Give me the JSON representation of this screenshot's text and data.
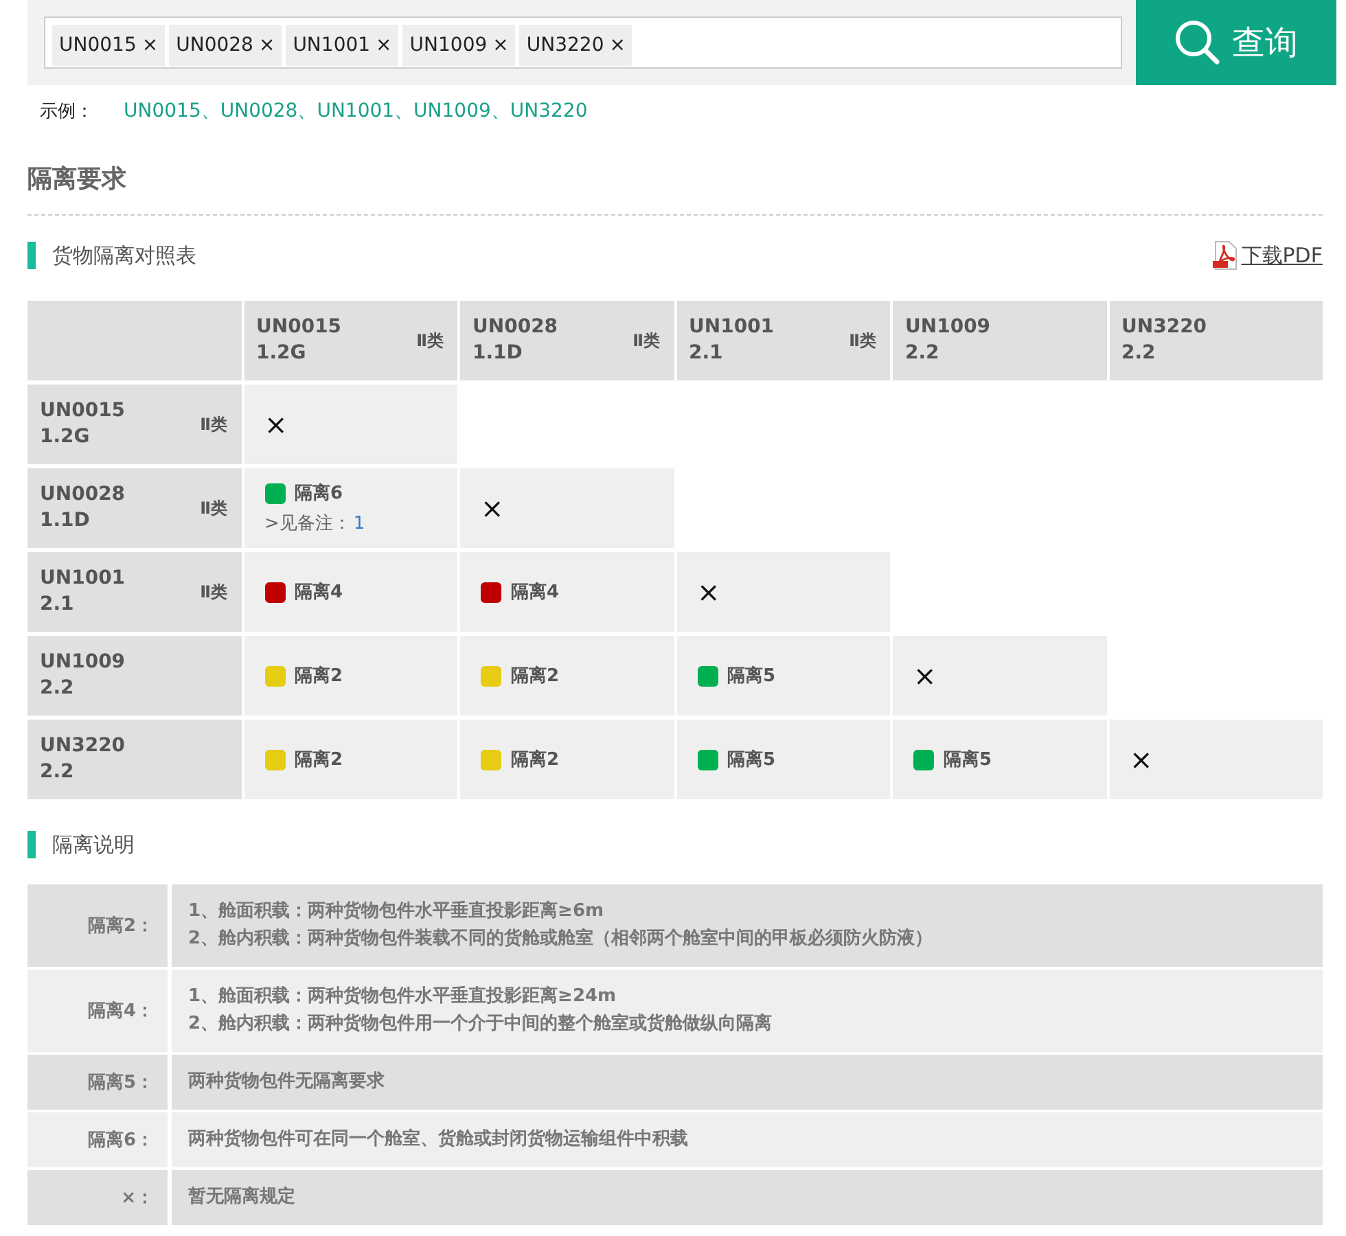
{
  "search": {
    "tags": [
      {
        "label": "UN0015",
        "remove": "×"
      },
      {
        "label": "UN0028",
        "remove": "×"
      },
      {
        "label": "UN1001",
        "remove": "×"
      },
      {
        "label": "UN1009",
        "remove": "×"
      },
      {
        "label": "UN3220",
        "remove": "×"
      }
    ],
    "button": "查询"
  },
  "example": {
    "label": "示例：",
    "value": "UN0015、UN0028、UN1001、UN1009、UN3220"
  },
  "section_title": "隔离要求",
  "matrix": {
    "title": "货物隔离对照表",
    "download": "下载PDF",
    "columns": [
      {
        "code": "UN0015",
        "class": "1.2G",
        "badge": "Ⅱ类"
      },
      {
        "code": "UN0028",
        "class": "1.1D",
        "badge": "Ⅱ类"
      },
      {
        "code": "UN1001",
        "class": "2.1",
        "badge": "Ⅱ类"
      },
      {
        "code": "UN1009",
        "class": "2.2"
      },
      {
        "code": "UN3220",
        "class": "2.2"
      }
    ],
    "rows": [
      {
        "code": "UN0015",
        "class": "1.2G",
        "badge": "Ⅱ类",
        "cells": [
          {
            "kind": "none",
            "text": "×"
          }
        ]
      },
      {
        "code": "UN0028",
        "class": "1.1D",
        "badge": "Ⅱ类",
        "cells": [
          {
            "kind": "level",
            "color": "#00b050",
            "label": "隔离6",
            "note": ">见备注：",
            "note_link": "1"
          },
          {
            "kind": "none",
            "text": "×"
          }
        ]
      },
      {
        "code": "UN1001",
        "class": "2.1",
        "badge": "Ⅱ类",
        "cells": [
          {
            "kind": "level",
            "color": "#c00000",
            "label": "隔离4"
          },
          {
            "kind": "level",
            "color": "#c00000",
            "label": "隔离4"
          },
          {
            "kind": "none",
            "text": "×"
          }
        ]
      },
      {
        "code": "UN1009",
        "class": "2.2",
        "cells": [
          {
            "kind": "level",
            "color": "#e6cc12",
            "label": "隔离2"
          },
          {
            "kind": "level",
            "color": "#e6cc12",
            "label": "隔离2"
          },
          {
            "kind": "level",
            "color": "#00b050",
            "label": "隔离5"
          },
          {
            "kind": "none",
            "text": "×"
          }
        ]
      },
      {
        "code": "UN3220",
        "class": "2.2",
        "cells": [
          {
            "kind": "level",
            "color": "#e6cc12",
            "label": "隔离2"
          },
          {
            "kind": "level",
            "color": "#e6cc12",
            "label": "隔离2"
          },
          {
            "kind": "level",
            "color": "#00b050",
            "label": "隔离5"
          },
          {
            "kind": "level",
            "color": "#00b050",
            "label": "隔离5"
          },
          {
            "kind": "none",
            "text": "×"
          }
        ]
      }
    ]
  },
  "legend": {
    "title": "隔离说明",
    "rows": [
      {
        "label": "隔离2：",
        "lines": [
          "1、舱面积载：两种货物包件水平垂直投影距离≥6m",
          "2、舱内积载：两种货物包件装载不同的货舱或舱室（相邻两个舱室中间的甲板必须防火防液）"
        ]
      },
      {
        "label": "隔离4：",
        "lines": [
          "1、舱面积载：两种货物包件水平垂直投影距离≥24m",
          "2、舱内积载：两种货物包件用一个介于中间的整个舱室或货舱做纵向隔离"
        ]
      },
      {
        "label": "隔离5：",
        "lines": [
          "两种货物包件无隔离要求"
        ]
      },
      {
        "label": "隔离6：",
        "lines": [
          "两种货物包件可在同一个舱室、货舱或封闭货物运输组件中积载"
        ]
      },
      {
        "label": "×：",
        "lines": [
          "暂无隔离规定"
        ]
      }
    ]
  }
}
